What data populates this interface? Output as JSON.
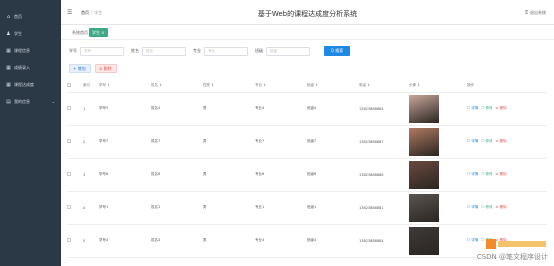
{
  "sidebar": {
    "items": [
      {
        "label": "首页",
        "icon": "home-icon",
        "glyph": "⌂"
      },
      {
        "label": "学生",
        "icon": "user-icon",
        "glyph": "♟"
      },
      {
        "label": "课程信息",
        "icon": "grid-icon",
        "glyph": "▦"
      },
      {
        "label": "成绩录入",
        "icon": "grid-icon",
        "glyph": "▦"
      },
      {
        "label": "课程达成度",
        "icon": "grid-icon",
        "glyph": "▦"
      },
      {
        "label": "我的信息",
        "icon": "document-icon",
        "glyph": "▤",
        "chevron": "⌄"
      }
    ]
  },
  "header": {
    "title": "基于Web的课程达成度分析系统",
    "breadcrumb_home": "首页",
    "breadcrumb_sep": "/",
    "breadcrumb_current": "学生",
    "logout": "退出系统"
  },
  "tags": {
    "home": "系统首页",
    "active": "学生 ×"
  },
  "search": {
    "fields": [
      {
        "label": "学号",
        "placeholder": "学号"
      },
      {
        "label": "姓名",
        "placeholder": "姓名"
      },
      {
        "label": "专业",
        "placeholder": "专业"
      },
      {
        "label": "班级",
        "placeholder": "班级"
      }
    ],
    "button": "Q 搜索"
  },
  "actions": {
    "add": "+ 增加",
    "delete": "⊘ 删除"
  },
  "table": {
    "headers": [
      "",
      "索引",
      "学号 ⇕",
      "姓名 ⇕",
      "性别 ⇕",
      "专业 ⇕",
      "班级 ⇕",
      "电话 ⇕",
      "头像 ⇕",
      "操作"
    ],
    "rows": [
      {
        "index": "1",
        "id": "学号5",
        "name": "姓名4",
        "gender": "男",
        "major": "专业4",
        "cls": "班级4",
        "phone": "13823888884",
        "photo_color": "#c8a79a"
      },
      {
        "index": "2",
        "id": "学号7",
        "name": "姓名7",
        "gender": "男",
        "major": "专业7",
        "cls": "班级7",
        "phone": "13823888887",
        "photo_color": "#b07a62"
      },
      {
        "index": "3",
        "id": "学号6",
        "name": "姓名6",
        "gender": "男",
        "major": "专业6",
        "cls": "班级6",
        "phone": "13823888886",
        "photo_color": "#6a4a3e"
      },
      {
        "index": "4",
        "id": "学号1",
        "name": "姓名1",
        "gender": "男",
        "major": "专业1",
        "cls": "班级1",
        "phone": "13823888881",
        "photo_color": "#5a5550"
      },
      {
        "index": "5",
        "id": "学号4",
        "name": "姓名4",
        "gender": "男",
        "major": "专业4",
        "cls": "班级4",
        "phone": "13823888884",
        "photo_color": "#3e3a38"
      }
    ],
    "ops": {
      "detail": "☐ 详情",
      "edit": "☐ 修改",
      "remove": "⊘ 删除"
    }
  },
  "watermark": "CSDN @笔文程序设计"
}
